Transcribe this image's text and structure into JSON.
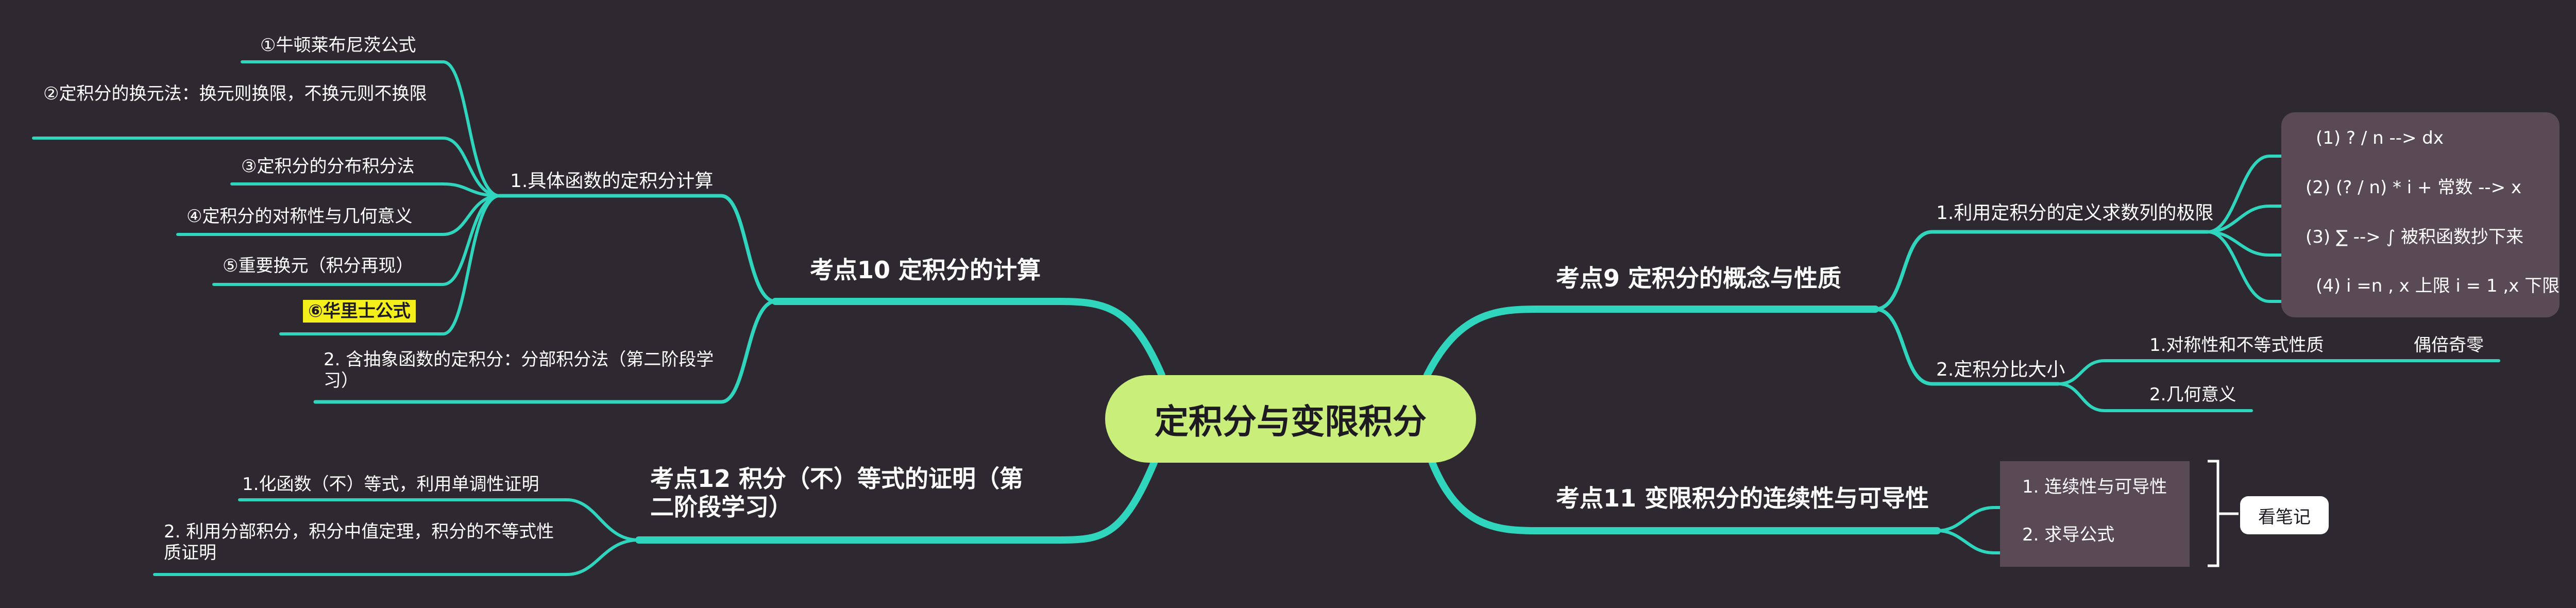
{
  "root": {
    "title": "定积分与变限积分"
  },
  "branches": {
    "k9": {
      "title": "考点9 定积分的概念与性质",
      "s1": {
        "title": "1.利用定积分的定义求数列的极限",
        "items": [
          "(1) ? / n --> dx",
          "(2) (? / n) * i + 常数 --> x",
          "(3) ∑ --> ∫ 被积函数抄下来",
          "(4) i =n , x 上限  i = 1 ,x 下限"
        ]
      },
      "s2": {
        "title": "2.定积分比大小",
        "c1": "1.对称性和不等式性质",
        "c1_child": "偶倍奇零",
        "c2": "2.几何意义"
      }
    },
    "k11": {
      "title": "考点11 变限积分的连续性与可导性",
      "items": [
        "1. 连续性与可导性",
        "2. 求导公式"
      ],
      "note": "看笔记"
    },
    "k10": {
      "title": "考点10 定积分的计算",
      "s1": {
        "title": "1.具体函数的定积分计算",
        "items": [
          "①牛顿莱布尼茨公式",
          "②定积分的换元法：换元则换限，不换元则不换限",
          "③定积分的分布积分法",
          "④定积分的对称性与几何意义",
          "⑤重要换元（积分再现）",
          "⑥华里士公式"
        ]
      },
      "s2": {
        "title": "2. 含抽象函数的定积分：分部积分法（第二阶段学习）"
      }
    },
    "k12": {
      "title": "考点12 积分（不）等式的证明（第二阶段学习）",
      "items": [
        "1.化函数（不）等式，利用单调性证明",
        "2. 利用分部积分，积分中值定理，积分的不等式性质证明"
      ]
    }
  },
  "colors": {
    "background": "#2e2930",
    "root": "#c9ee7a",
    "link": "#2fd5bd",
    "highlight": "#f4ee1a",
    "box": "#5a4a56"
  }
}
